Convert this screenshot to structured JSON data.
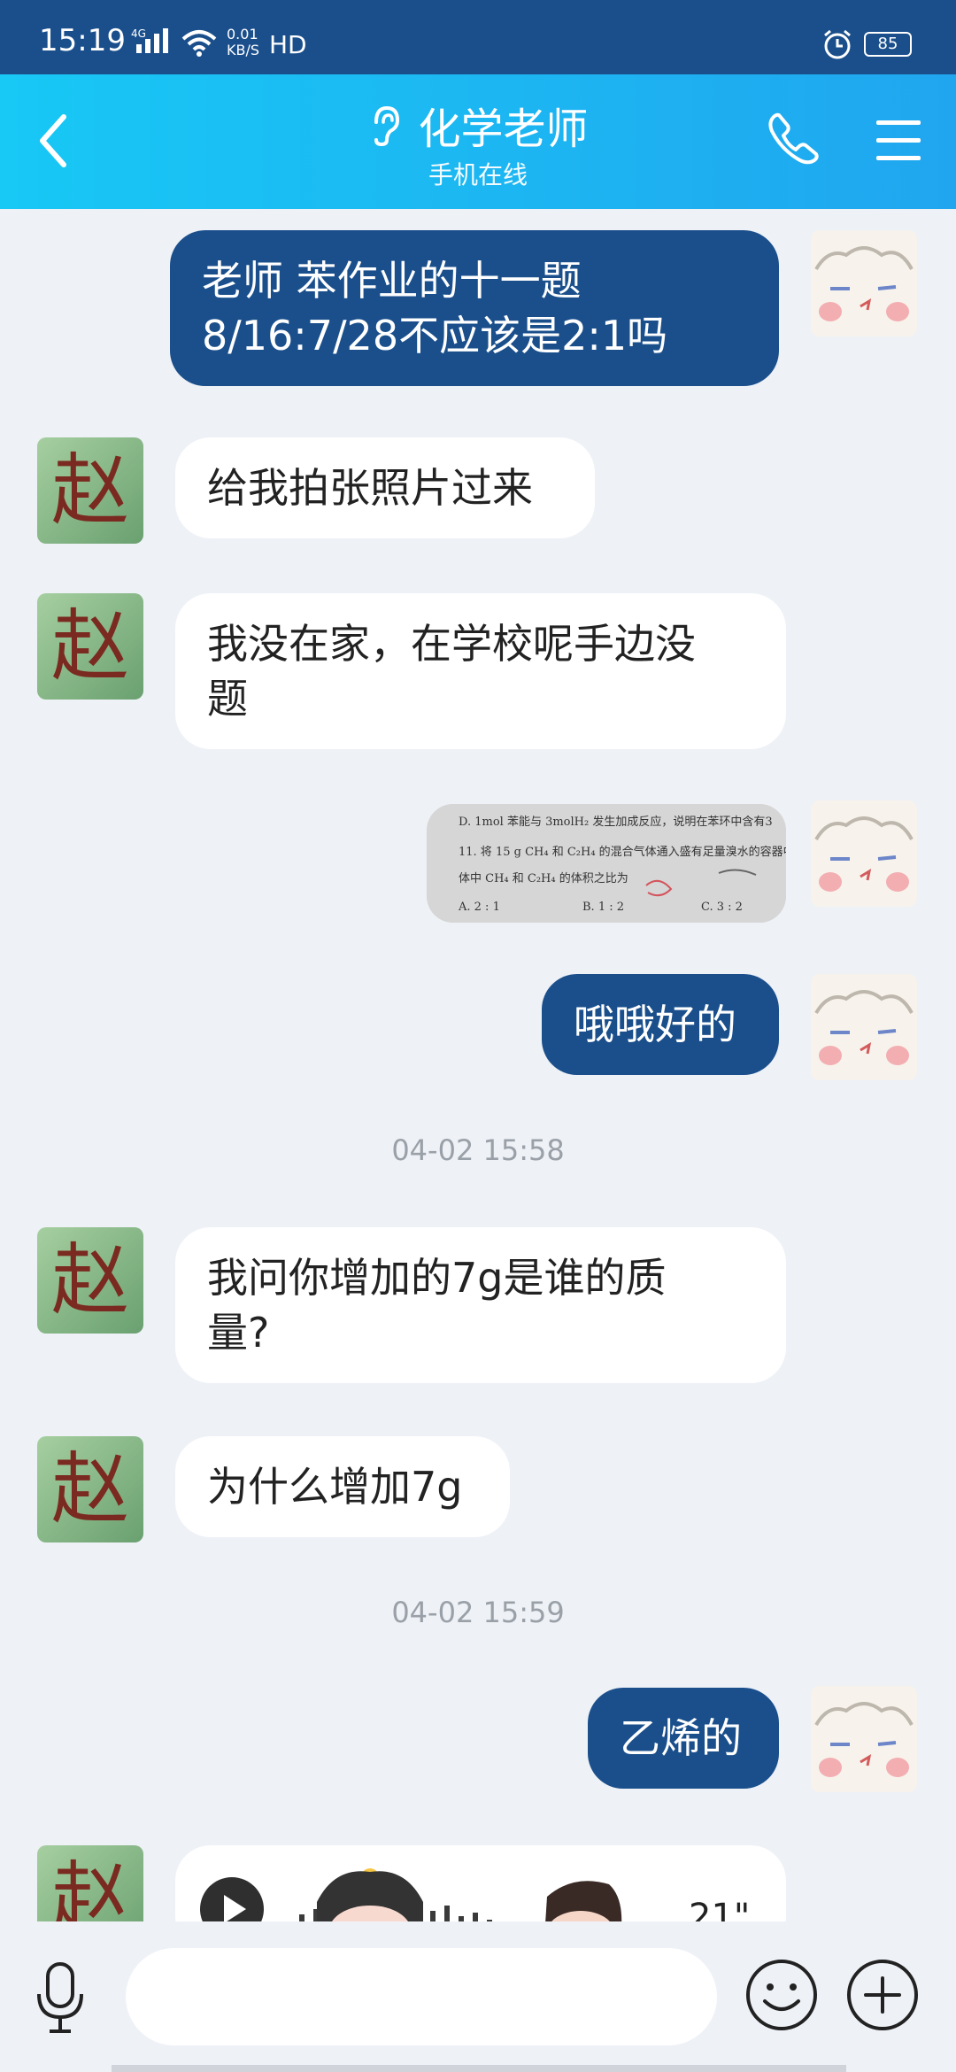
{
  "status_bar": {
    "time": "15:19",
    "network": "4G",
    "speed_value": "0.01",
    "speed_unit": "KB/S",
    "hd": "HD",
    "battery": "85"
  },
  "header": {
    "title": "化学老师",
    "subtitle": "手机在线",
    "icons": [
      "back-icon",
      "ear-icon",
      "phone-icon",
      "menu-icon"
    ]
  },
  "messages": [
    {
      "from": "me",
      "text_line1": "老师 苯作业的十一题",
      "text_line2": "8/16:7/28不应该是2:1吗"
    },
    {
      "from": "teacher",
      "text": "给我拍张照片过来"
    },
    {
      "from": "teacher",
      "text_line1": "我没在家，在学校呢手边没",
      "text_line2": "题"
    },
    {
      "from": "me",
      "type": "image",
      "photo_lines": [
        "D. 1mol 苯能与 3molH₂ 发生加成反应，说明在苯环中含有3",
        "11. 将 15 g CH₄ 和 C₂H₄ 的混合气体通入盛有足量溴水的容器中",
        "体中 CH₄ 和 C₂H₄ 的体积之比为",
        "A. 2 : 1",
        "B. 1 : 2",
        "C. 3 : 2"
      ]
    },
    {
      "from": "me",
      "text": "哦哦好的"
    },
    {
      "type": "timestamp",
      "text": "04-02 15:58"
    },
    {
      "from": "teacher",
      "text_line1": "我问你增加的7g是谁的质",
      "text_line2": "量?"
    },
    {
      "from": "teacher",
      "text": "为什么增加7g"
    },
    {
      "type": "timestamp",
      "text": "04-02 15:59"
    },
    {
      "from": "me",
      "text": "乙烯的"
    },
    {
      "from": "teacher",
      "type": "voice",
      "duration": "21\""
    }
  ],
  "teacher_avatar_char": "赵",
  "input": {
    "value": "",
    "placeholder": ""
  },
  "colors": {
    "header_start": "#18c8f5",
    "header_end": "#20a6ef",
    "outgoing_bubble": "#1a4f8c",
    "status_bar": "#1a4f8c"
  }
}
